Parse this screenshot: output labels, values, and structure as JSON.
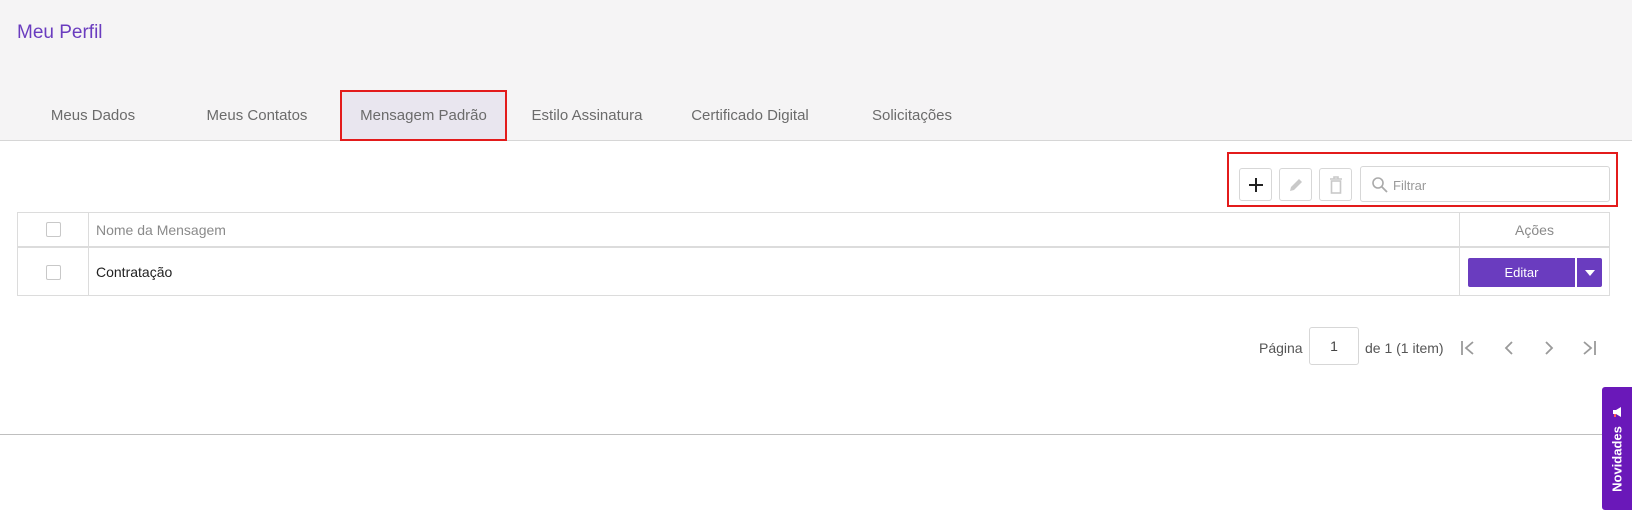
{
  "page": {
    "title": "Meu Perfil"
  },
  "tabs": [
    {
      "label": "Meus Dados"
    },
    {
      "label": "Meus Contatos"
    },
    {
      "label": "Mensagem Padrão",
      "active": true
    },
    {
      "label": "Estilo Assinatura"
    },
    {
      "label": "Certificado Digital"
    },
    {
      "label": "Solicitações"
    }
  ],
  "toolbar": {
    "add_icon": "plus-icon",
    "edit_icon": "pencil-icon",
    "delete_icon": "trash-icon",
    "filter_placeholder": "Filtrar",
    "filter_value": ""
  },
  "table": {
    "columns": {
      "name": "Nome da Mensagem",
      "actions": "Ações"
    },
    "rows": [
      {
        "name": "Contratação",
        "edit_label": "Editar"
      }
    ]
  },
  "pagination": {
    "page_label": "Página",
    "current_page": "1",
    "summary": "de 1 (1 item)"
  },
  "novidades": {
    "label": "Novidades"
  },
  "colors": {
    "accent": "#6a3cbf",
    "highlight": "#e31b1b",
    "novidades_bg": "#6a18b9"
  }
}
